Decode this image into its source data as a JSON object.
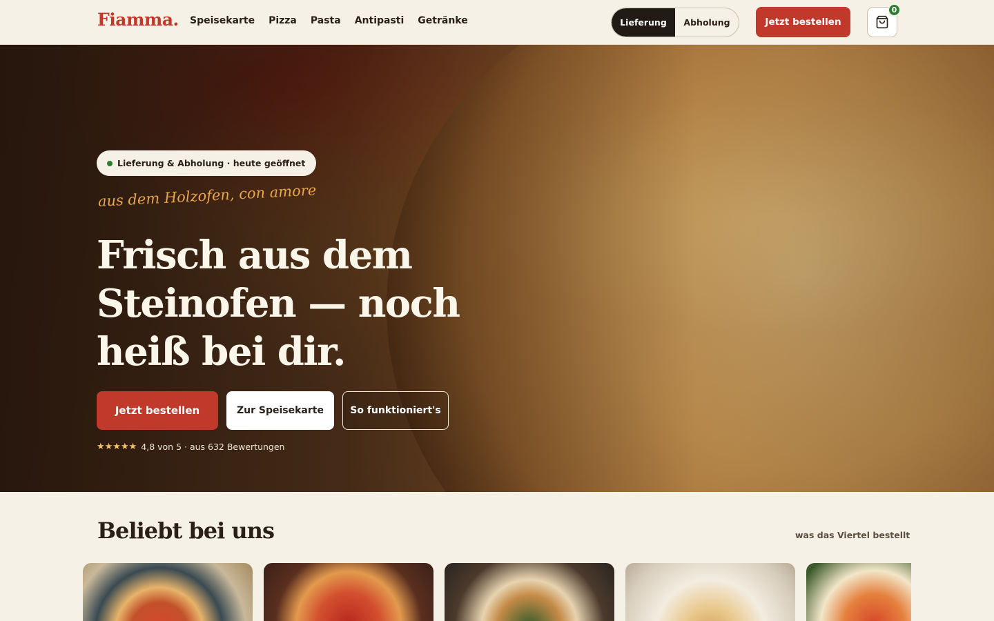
{
  "header": {
    "logo": "Fiamma.",
    "nav": [
      "Speisekarte",
      "Pizza",
      "Pasta",
      "Antipasti",
      "Getränke"
    ],
    "mode_toggle": {
      "options": [
        "Lieferung",
        "Abholung"
      ],
      "selected": "Lieferung"
    },
    "order_button": "Jetzt bestellen",
    "cart_count": "0",
    "cart_icon": "shopping-bag-icon"
  },
  "hero": {
    "badge": "Lieferung & Abholung · heute geöffnet",
    "script_tagline": "aus dem Holzofen, con amore",
    "headline": "Frisch aus dem Steinofen — noch heiß bei dir.",
    "buttons": {
      "primary": "Jetzt bestellen",
      "menu": "Zur Speisekarte",
      "how": "So funktioniert's"
    },
    "stars": "★★★★★",
    "rating_text": "4,8 von 5 · aus 632 Bewertungen"
  },
  "popular": {
    "title": "Beliebt bei uns",
    "subtitle": "was das Viertel bestellt"
  },
  "colors": {
    "brand": "#c0392b",
    "dark": "#221a14",
    "cream": "#f6f1e6",
    "open": "#2e7d32",
    "accent_script": "#e8a64a"
  }
}
